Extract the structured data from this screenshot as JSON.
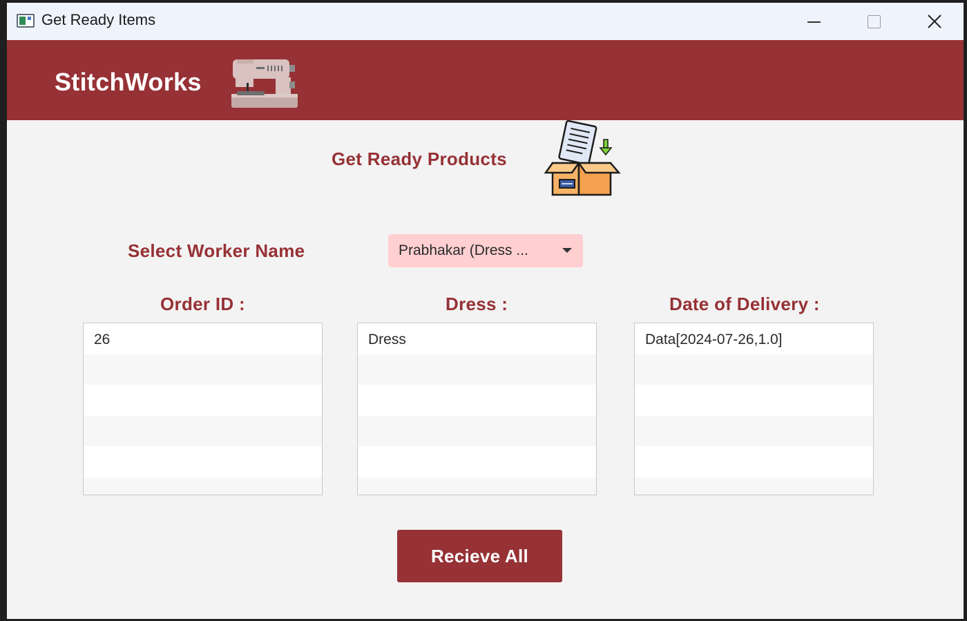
{
  "window": {
    "title": "Get Ready Items",
    "icons": {
      "app": "app-window-icon",
      "minimize": "minimize-icon",
      "maximize": "maximize-icon",
      "close": "close-icon"
    }
  },
  "brand": {
    "name": "StitchWorks",
    "icon": "sewing-machine-icon",
    "color": "#963135"
  },
  "page": {
    "heading": "Get Ready Products",
    "heading_icon": "package-checklist-icon"
  },
  "worker": {
    "label": "Select Worker Name",
    "selected": "Prabhakar (Dress ...",
    "dropdown_icon": "caret-down-icon",
    "background": "#ffcfd1"
  },
  "columns": {
    "order_id": {
      "label": "Order ID :",
      "rows": [
        "26",
        "",
        "",
        "",
        "",
        ""
      ]
    },
    "dress": {
      "label": "Dress :",
      "rows": [
        "Dress",
        "",
        "",
        "",
        "",
        ""
      ]
    },
    "delivery": {
      "label": "Date of Delivery :",
      "rows": [
        "Data[2024-07-26,1.0]",
        "",
        "",
        "",
        "",
        ""
      ]
    }
  },
  "actions": {
    "receive_all": "Recieve All"
  }
}
